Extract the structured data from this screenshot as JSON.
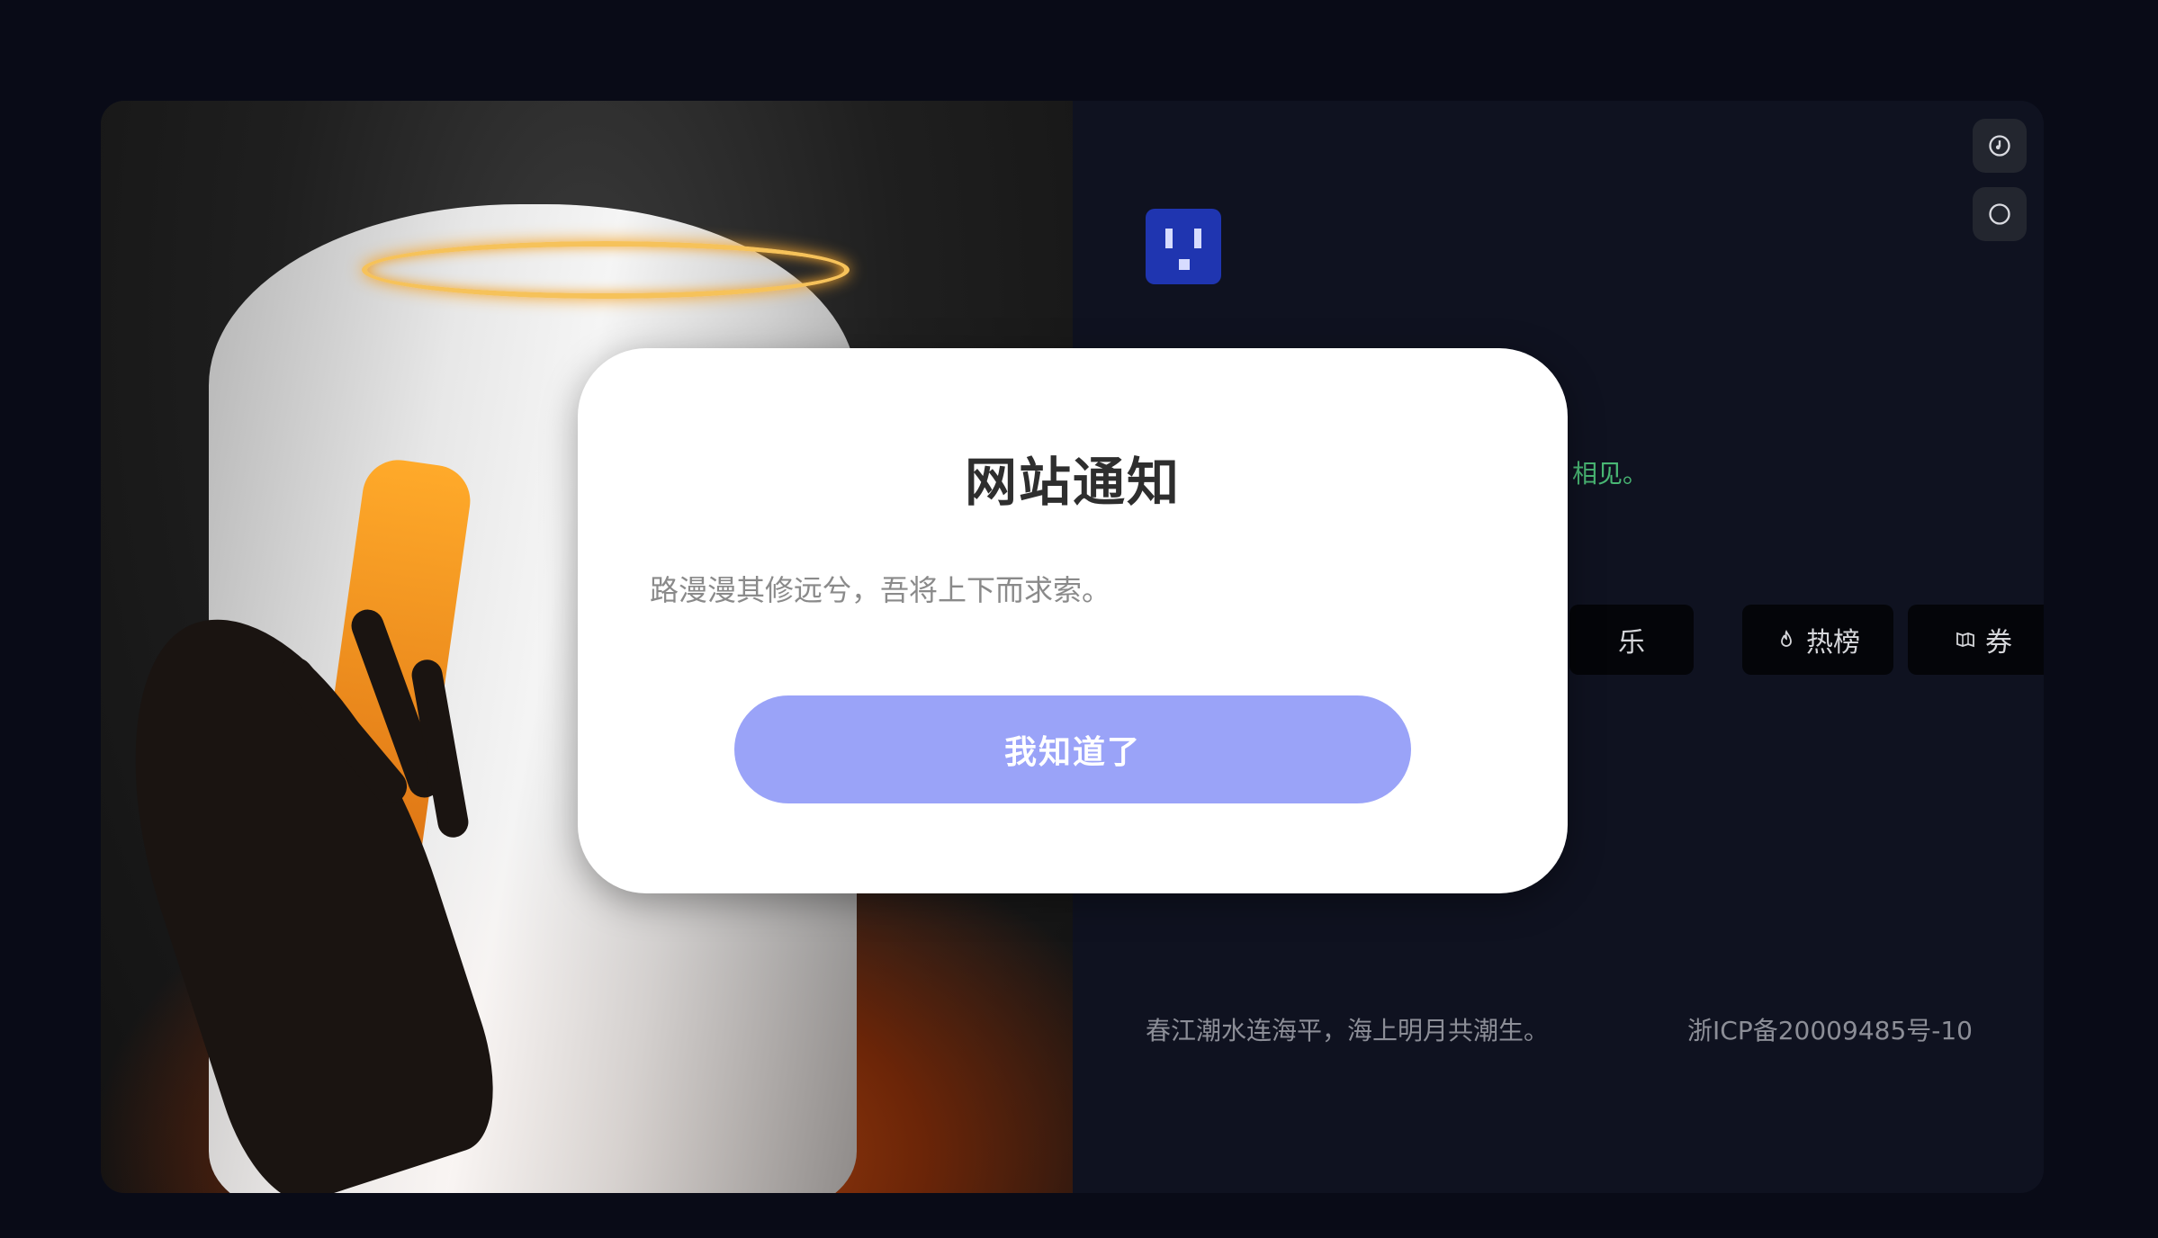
{
  "modal": {
    "title": "网站通知",
    "message": "路漫漫其修远兮，吾将上下而求索。",
    "confirm_label": "我知道了"
  },
  "main": {
    "status_text": "相见。",
    "nav_chips": [
      {
        "label": "乐",
        "icon": ""
      },
      {
        "label": "热榜",
        "icon": "flame-icon"
      },
      {
        "label": "券",
        "icon": "ticket-icon"
      }
    ]
  },
  "toolbar": {
    "music_icon": "music-icon",
    "theme_icon": "theme-toggle-icon"
  },
  "footer": {
    "quote": "春江潮水连海平，海上明月共潮生。",
    "icp": "浙ICP备20009485号-10"
  },
  "colors": {
    "page_bg": "#090b17",
    "card_bg": "#0f1220",
    "status_green": "#49b774",
    "modal_button": "#9aa3f8",
    "logo_blue": "#1f35b0"
  }
}
